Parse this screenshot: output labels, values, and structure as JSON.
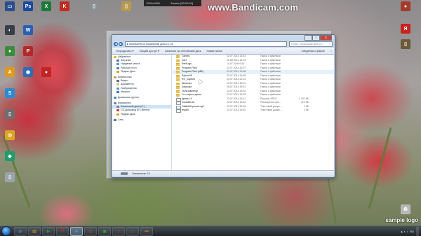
{
  "overlay": {
    "watermark": "www.Bandicam.com",
    "recorder_text": "1920x1080",
    "recorder_text2": "Запись [00:00:04]",
    "corner_logo": "sample logo"
  },
  "desktop_icons": [
    {
      "label": "",
      "color": "#2b4e8f",
      "glyph": "▭"
    },
    {
      "label": "",
      "color": "#1b4a9e",
      "glyph": "Ps"
    },
    {
      "label": "",
      "color": "#1d7a3a",
      "glyph": "X"
    },
    {
      "label": "",
      "color": "#c42a1f",
      "glyph": "K"
    },
    {
      "label": "",
      "color": "#8b8f96",
      "glyph": "▯"
    },
    {
      "label": "",
      "color": "#b89a4e",
      "glyph": "▯"
    },
    {
      "label": "",
      "color": "#a63a2a",
      "glyph": "●"
    },
    {
      "label": "",
      "color": "#3a3f47",
      "glyph": "◐"
    },
    {
      "label": "",
      "color": "#2b5fb1",
      "glyph": "W"
    },
    {
      "label": "",
      "color": "#c7231d",
      "glyph": "Я"
    },
    {
      "label": "",
      "color": "#3b8b3c",
      "glyph": "●"
    },
    {
      "label": "",
      "color": "#b12a2a",
      "glyph": "P"
    },
    {
      "label": "",
      "color": "#e09a1a",
      "glyph": "A"
    },
    {
      "label": "",
      "color": "#2a6db8",
      "glyph": "◉"
    },
    {
      "label": "",
      "color": "#c02424",
      "glyph": "●"
    },
    {
      "label": "",
      "color": "#2a8bd0",
      "glyph": "S"
    },
    {
      "label": "",
      "color": "#6e6e6e",
      "glyph": "▯"
    },
    {
      "label": "",
      "color": "#d8a622",
      "glyph": "◎"
    },
    {
      "label": "",
      "color": "#1f9e6a",
      "glyph": "◆"
    },
    {
      "label": "",
      "color": "#9aa3ab",
      "glyph": "▯"
    },
    {
      "label": "",
      "color": "#6a5a3a",
      "glyph": "▯"
    },
    {
      "label": "",
      "color": "#b8b8b8",
      "glyph": "♻"
    }
  ],
  "explorer": {
    "address": "▸ Компьютер ▸ Локальный диск (C:) ▸",
    "search_placeholder": "Поиск: Локальный диск (C:)",
    "toolbar": {
      "organize": "Упорядочить ▾",
      "share": "Общий доступ ▾",
      "burn": "Записать на оптический диск",
      "new_folder": "Новая папка",
      "view": "Сведения о файле"
    },
    "nav": [
      {
        "label": "Избранное",
        "type": "hdr",
        "color": "#e5b53b"
      },
      {
        "label": "Загрузки",
        "type": "item",
        "color": "#4a78b8"
      },
      {
        "label": "Недавние места",
        "type": "item",
        "color": "#6a8fbe"
      },
      {
        "label": "Рабочий стол",
        "type": "item",
        "color": "#4a88c8"
      },
      {
        "label": "Яндекс.Диск",
        "type": "item",
        "color": "#e0a02a"
      },
      {
        "label": "Библиотеки",
        "type": "hdr gap",
        "color": "#c9a34a"
      },
      {
        "label": "Видео",
        "type": "item",
        "color": "#5a6e8a"
      },
      {
        "label": "Документы",
        "type": "item",
        "color": "#e0c070"
      },
      {
        "label": "Изображения",
        "type": "item",
        "color": "#5a9ac8"
      },
      {
        "label": "Музыка",
        "type": "item",
        "color": "#3a7ab8"
      },
      {
        "label": "Домашняя группа",
        "type": "hdr gap",
        "color": "#4a8acb"
      },
      {
        "label": "Компьютер",
        "type": "hdr gap",
        "color": "#6a88a8"
      },
      {
        "label": "Локальный диск (C:)",
        "type": "item sel",
        "color": "#7a8898"
      },
      {
        "label": "CD-дисковод (E:) Beeline",
        "type": "item",
        "color": "#d04040"
      },
      {
        "label": "Яндекс.Диск",
        "type": "item",
        "color": "#e0a02a"
      },
      {
        "label": "Сеть",
        "type": "hdr gap",
        "color": "#4a78a8"
      }
    ],
    "files": [
      {
        "name": "Games",
        "date": "22.07.2014 13:53",
        "type": "Папка с файлами",
        "size": "",
        "kind": "folder"
      },
      {
        "name": "Intel",
        "date": "02.08.2014 14:34",
        "type": "Папка с файлами",
        "size": "",
        "kind": "folder"
      },
      {
        "name": "PerfLogs",
        "date": "14.07.2009 6:20",
        "type": "Папка с файлами",
        "size": "",
        "kind": "folder"
      },
      {
        "name": "Program Files",
        "date": "22.07.2014 13:07",
        "type": "Папка с файлами",
        "size": "",
        "kind": "folder"
      },
      {
        "name": "Program Files (x86)",
        "date": "22.07.2014 13:58",
        "type": "Папка с файлами",
        "size": "",
        "kind": "folder"
      },
      {
        "name": "Python25",
        "date": "22.07.2014 13:58",
        "type": "Папка с файлами",
        "size": "",
        "kind": "folder"
      },
      {
        "name": "RS_Capture",
        "date": "22.07.2014 22:43",
        "type": "Папка с файлами",
        "size": "",
        "kind": "folder"
      },
      {
        "name": "Windows",
        "date": "22.07.2014 13:10",
        "type": "Папка с файлами",
        "size": "",
        "kind": "folder"
      },
      {
        "name": "Загрузки",
        "date": "26.07.2014 19:51",
        "type": "Папка с файлами",
        "size": "",
        "kind": "folder"
      },
      {
        "name": "Пользователи",
        "date": "22.07.2014 13:03",
        "type": "Папка с файлами",
        "size": "",
        "kind": "folder"
      },
      {
        "name": "Со старого диска",
        "date": "22.07.2014 13:53",
        "type": "Папка с файлами",
        "size": "",
        "kind": "folder"
      },
      {
        "name": "Igame 19",
        "date": "22.07.2014 22:41",
        "type": "Рисунок JPEG",
        "size": "1 197 КБ",
        "kind": "doc"
      },
      {
        "name": "modal60.dll",
        "date": "22.07.2014 13:42",
        "type": "Расширение при...",
        "size": "474 КБ",
        "kind": "doc"
      },
      {
        "name": "OfaltekExpressLog2",
        "date": "22.07.2014 13:46",
        "type": "Текстовый докум...",
        "size": "1 КБ",
        "kind": "doc"
      },
      {
        "name": "repath",
        "date": "22.07.2014 13:52",
        "type": "Текстовый докум...",
        "size": "1 КБ",
        "kind": "doc"
      }
    ],
    "status": "Элементов: 15"
  },
  "taskbar": {
    "items": [
      {
        "glyph": "◉",
        "color": "#3a78c8"
      },
      {
        "glyph": "▤",
        "color": "#c8a23a"
      },
      {
        "glyph": "▶",
        "color": "#3a8a4a"
      },
      {
        "glyph": "Я",
        "color": "#c8302a"
      },
      {
        "glyph": "◈",
        "color": "#6a8fd0"
      },
      {
        "glyph": "◎",
        "color": "#d04a3a"
      },
      {
        "glyph": "▣",
        "color": "#4a9a4a"
      },
      {
        "glyph": "●",
        "color": "#c02a2a"
      },
      {
        "glyph": "▭",
        "color": "#7a7a7a"
      },
      {
        "glyph": "▬",
        "color": "#9a6a3a"
      }
    ],
    "active_index": 4,
    "tray": {
      "lang": "RU",
      "icons": "▲ ◐ ♪"
    }
  }
}
